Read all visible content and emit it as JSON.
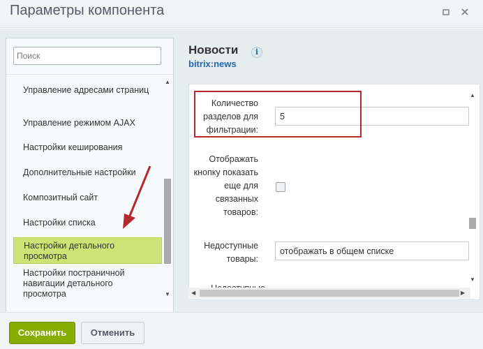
{
  "window": {
    "title": "Параметры компонента"
  },
  "search": {
    "placeholder": "Поиск"
  },
  "sidebar": {
    "items": [
      {
        "label": "Управление адресами страниц"
      },
      {
        "label": "Управление режимом AJAX"
      },
      {
        "label": "Настройки кеширования"
      },
      {
        "label": "Дополнительные настройки"
      },
      {
        "label": "Композитный сайт"
      },
      {
        "label": "Настройки списка"
      },
      {
        "label": "Настройки детального просмотра",
        "active": true
      },
      {
        "label": "Настройки постраничной навигации детального просмотра"
      }
    ]
  },
  "component": {
    "name": "Новости",
    "code": "bitrix:news",
    "info_icon": "i"
  },
  "form": {
    "fields": [
      {
        "label": "Количество разделов для фильтрации:",
        "value": "5"
      },
      {
        "label": "Отображать кнопку показать еще для связанных товаров:",
        "type": "checkbox"
      },
      {
        "label": "Недоступные товары:",
        "value": "отображать в общем списке"
      },
      {
        "label": "Недоступные"
      }
    ]
  },
  "buttons": {
    "save": "Сохранить",
    "cancel": "Отменить"
  },
  "colors": {
    "accent_green": "#86ad00",
    "active_item": "#cde375",
    "annotation_red": "#b5282b",
    "link_blue": "#2067b0"
  }
}
